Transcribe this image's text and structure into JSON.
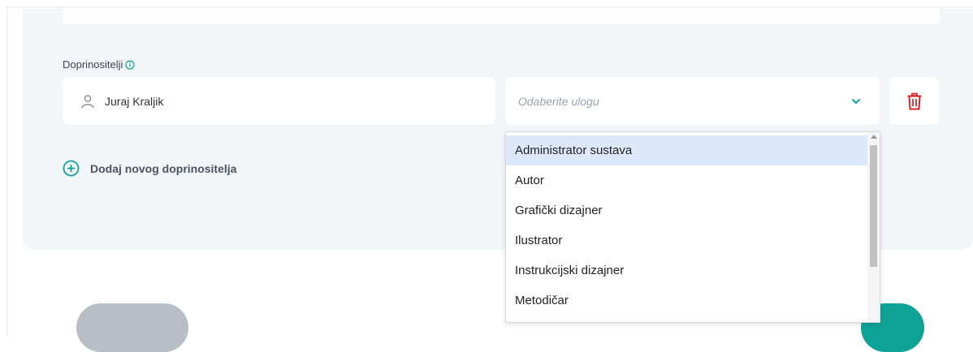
{
  "section": {
    "label": "Doprinositelji",
    "info_icon": "info-circle-icon"
  },
  "contributor": {
    "name": "Juraj Kraljik",
    "icon": "user-icon"
  },
  "role_select": {
    "placeholder": "Odaberite ulogu",
    "icon": "chevron-down-icon"
  },
  "delete_button": {
    "icon": "trash-icon"
  },
  "add_contributor": {
    "label": "Dodaj novog doprinositelja",
    "icon": "plus-circle-icon"
  },
  "dropdown": {
    "options": [
      "Administrator sustava",
      "Autor",
      "Grafički dizajner",
      "Ilustrator",
      "Instrukcijski dizajner",
      "Metodičar"
    ],
    "highlighted_index": 0
  },
  "colors": {
    "accent": "#0fa296",
    "danger": "#d9262c",
    "panel_bg": "#f2f6f9",
    "highlight": "#dde8fb"
  }
}
